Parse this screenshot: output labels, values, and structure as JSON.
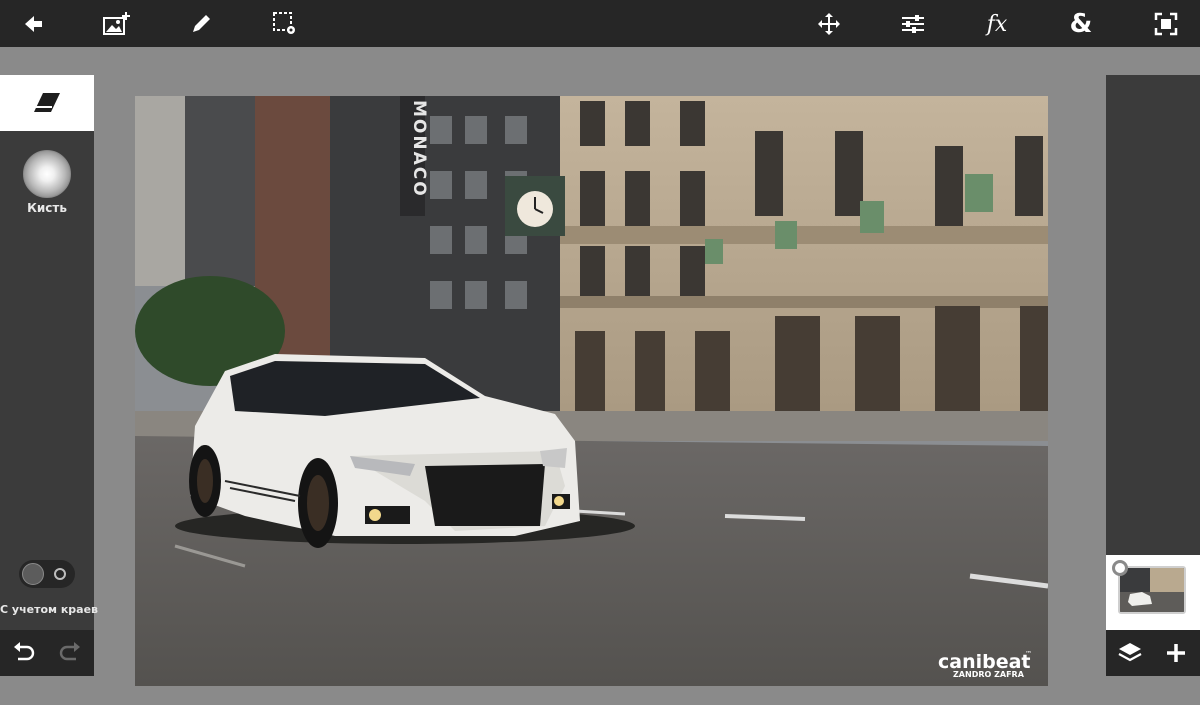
{
  "toolbar": {
    "left_tools": [
      {
        "name": "back-arrow-icon"
      },
      {
        "name": "add-image-icon"
      },
      {
        "name": "pencil-icon"
      },
      {
        "name": "selection-settings-icon"
      }
    ],
    "right_tools": [
      {
        "name": "move-icon"
      },
      {
        "name": "adjustments-icon"
      },
      {
        "name": "fx-icon",
        "text": "fx"
      },
      {
        "name": "blend-icon",
        "text": "&"
      },
      {
        "name": "fit-screen-icon"
      }
    ]
  },
  "left_panel": {
    "active_tool_icon": "eraser-icon",
    "brush_label": "Кисть",
    "edge_toggle_label": "С учетом краев",
    "edge_toggle_on": false
  },
  "canvas": {
    "photo_description": "White sedan driving on a city street",
    "watermark_line1": "canibeat",
    "watermark_tm": "™",
    "watermark_line2": "ZANDRO ZAFRA",
    "building_sign": "MONACO"
  },
  "right_panel": {
    "layer_count": 1
  },
  "colors": {
    "toolbar_bg": "#262626",
    "panel_bg": "#3b3b3b",
    "workspace_bg": "#8a8a8a",
    "active_tab_bg": "#ffffff",
    "icon_color": "#ffffff"
  }
}
